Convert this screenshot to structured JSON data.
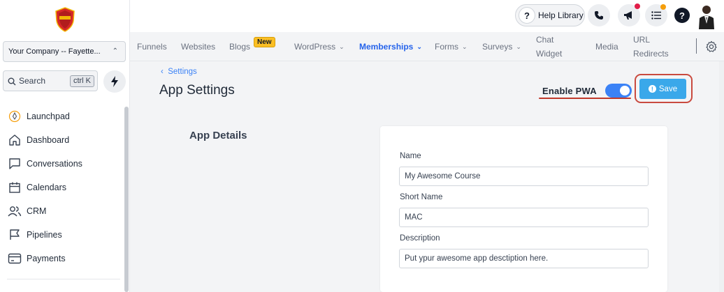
{
  "sidebar": {
    "company": "Your Company -- Fayette...",
    "search_placeholder": "Search",
    "search_shortcut": "ctrl K",
    "items": [
      {
        "label": "Launchpad",
        "icon": "rocket-icon"
      },
      {
        "label": "Dashboard",
        "icon": "home-icon"
      },
      {
        "label": "Conversations",
        "icon": "chat-icon"
      },
      {
        "label": "Calendars",
        "icon": "calendar-icon"
      },
      {
        "label": "CRM",
        "icon": "users-icon"
      },
      {
        "label": "Pipelines",
        "icon": "flag-icon"
      },
      {
        "label": "Payments",
        "icon": "card-icon"
      }
    ]
  },
  "header": {
    "help_label": "Help Library",
    "help_glyph": "?",
    "question_glyph": "?"
  },
  "subnav": {
    "tabs": [
      {
        "label": "Funnels"
      },
      {
        "label": "Websites"
      },
      {
        "label": "Blogs",
        "badge": "New"
      },
      {
        "label": "WordPress",
        "caret": "⌄"
      },
      {
        "label": "Memberships",
        "caret": "⌄"
      },
      {
        "label": "Forms",
        "caret": "⌄"
      },
      {
        "label": "Surveys",
        "caret": "⌄"
      },
      {
        "label_line1": "Chat",
        "label_line2": "Widget"
      },
      {
        "label": "Media"
      },
      {
        "label_line1": "URL",
        "label_line2": "Redirects"
      }
    ]
  },
  "page": {
    "breadcrumb": "Settings",
    "breadcrumb_arrow": "‹",
    "title": "App Settings",
    "pwa_label": "Enable PWA",
    "save_label": "Save",
    "save_info_glyph": "!",
    "section_title": "App Details",
    "fields": {
      "name_label": "Name",
      "name_value": "My Awesome Course",
      "short_name_label": "Short Name",
      "short_name_value": "MAC",
      "description_label": "Description",
      "description_value": "Put ypur awesome app desctiption here."
    }
  },
  "colors": {
    "accent": "#2563eb",
    "save": "#3aa8ea",
    "annotation": "#c94a3f",
    "badge": "#fbbf24"
  }
}
